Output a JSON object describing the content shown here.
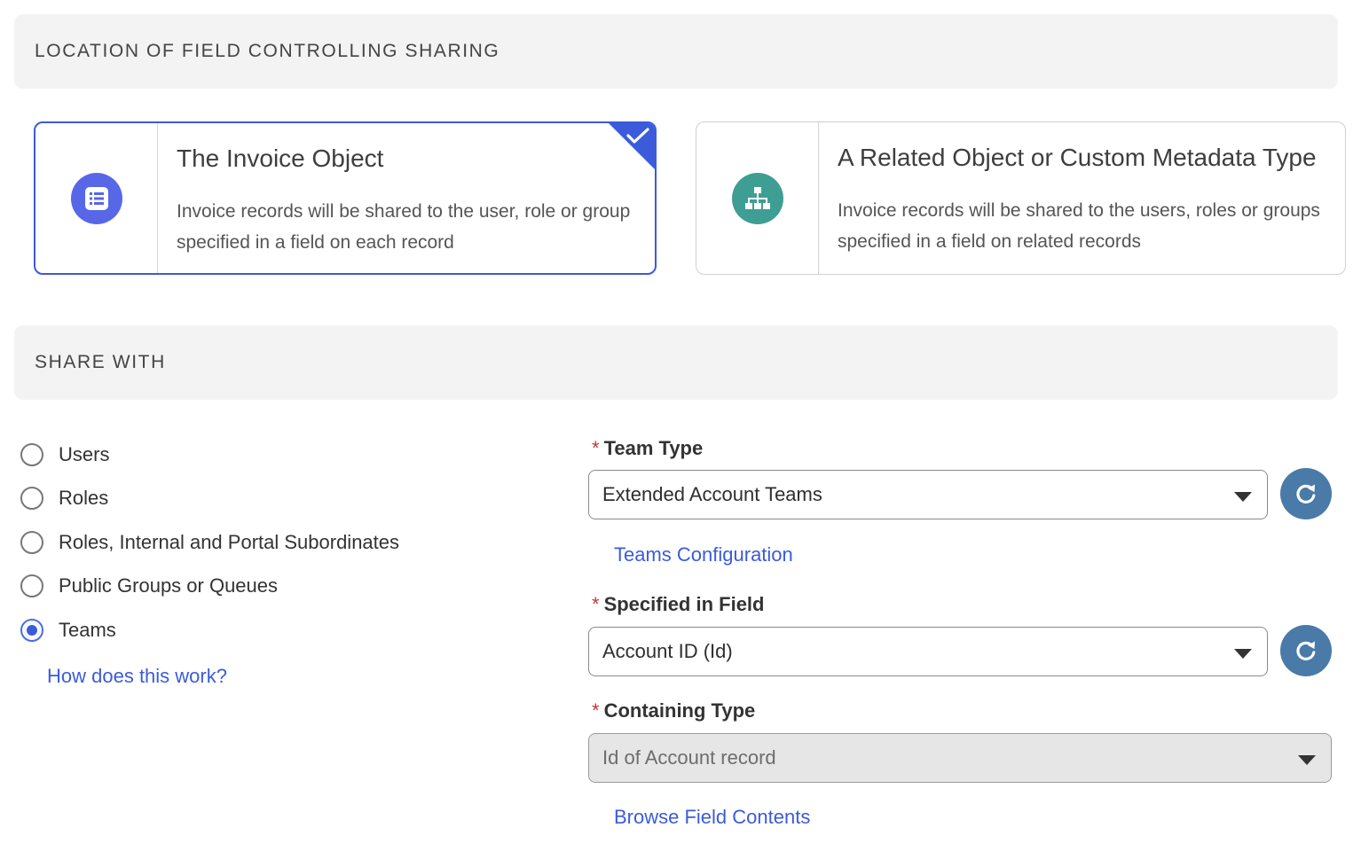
{
  "sections": {
    "location_title": "LOCATION OF FIELD CONTROLLING SHARING",
    "share_title": "SHARE WITH"
  },
  "cards": [
    {
      "title": "The Invoice Object",
      "description": "Invoice records will be shared to the user, role or group specified in a field on each record",
      "icon": "list-icon",
      "icon_color": "#5867e8",
      "selected": true
    },
    {
      "title": "A Related Object or Custom Metadata Type",
      "description": "Invoice records will be shared to the users, roles or groups specified in a field on related records",
      "icon": "hierarchy-icon",
      "icon_color": "#3e9e93",
      "selected": false
    }
  ],
  "share_with": {
    "options": [
      "Users",
      "Roles",
      "Roles, Internal and Portal Subordinates",
      "Public Groups or Queues",
      "Teams"
    ],
    "selected": "Teams",
    "help_link": "How does this work?"
  },
  "fields": {
    "team_type": {
      "label": "Team Type",
      "required_mark": "*",
      "value": "Extended Account Teams",
      "link": "Teams Configuration"
    },
    "specified_in_field": {
      "label": "Specified in Field",
      "required_mark": "*",
      "value": "Account ID (Id)"
    },
    "containing_type": {
      "label": "Containing Type",
      "required_mark": "*",
      "value": "Id of Account record",
      "disabled": true,
      "link": "Browse Field Contents"
    }
  },
  "colors": {
    "accent": "#3b5bdb",
    "refresh_button": "#4a7aa8",
    "required": "#c23934"
  }
}
